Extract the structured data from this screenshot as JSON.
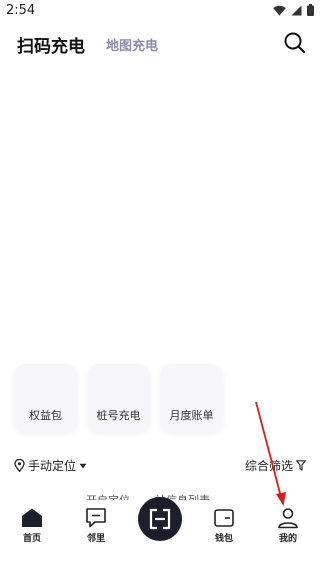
{
  "status_bar": {
    "time": "2:54"
  },
  "header": {
    "tab_scan_label": "扫码充电",
    "tab_map_label": "地图充电"
  },
  "cards": [
    {
      "label": "权益包"
    },
    {
      "label": "桩号充电"
    },
    {
      "label": "月度账单"
    }
  ],
  "filter_row": {
    "location_label": "手动定位",
    "filter_label": "综合筛选"
  },
  "hint": {
    "text": "开启定位，... 站信息列表"
  },
  "bottom_nav": {
    "items": [
      {
        "label": "首页"
      },
      {
        "label": "邻里"
      },
      {
        "label": "钱包"
      },
      {
        "label": "我的"
      }
    ]
  },
  "colors": {
    "accent": "#1c1f2b",
    "tab_inactive": "#8a8ca8",
    "annotation": "#d61f1f"
  }
}
